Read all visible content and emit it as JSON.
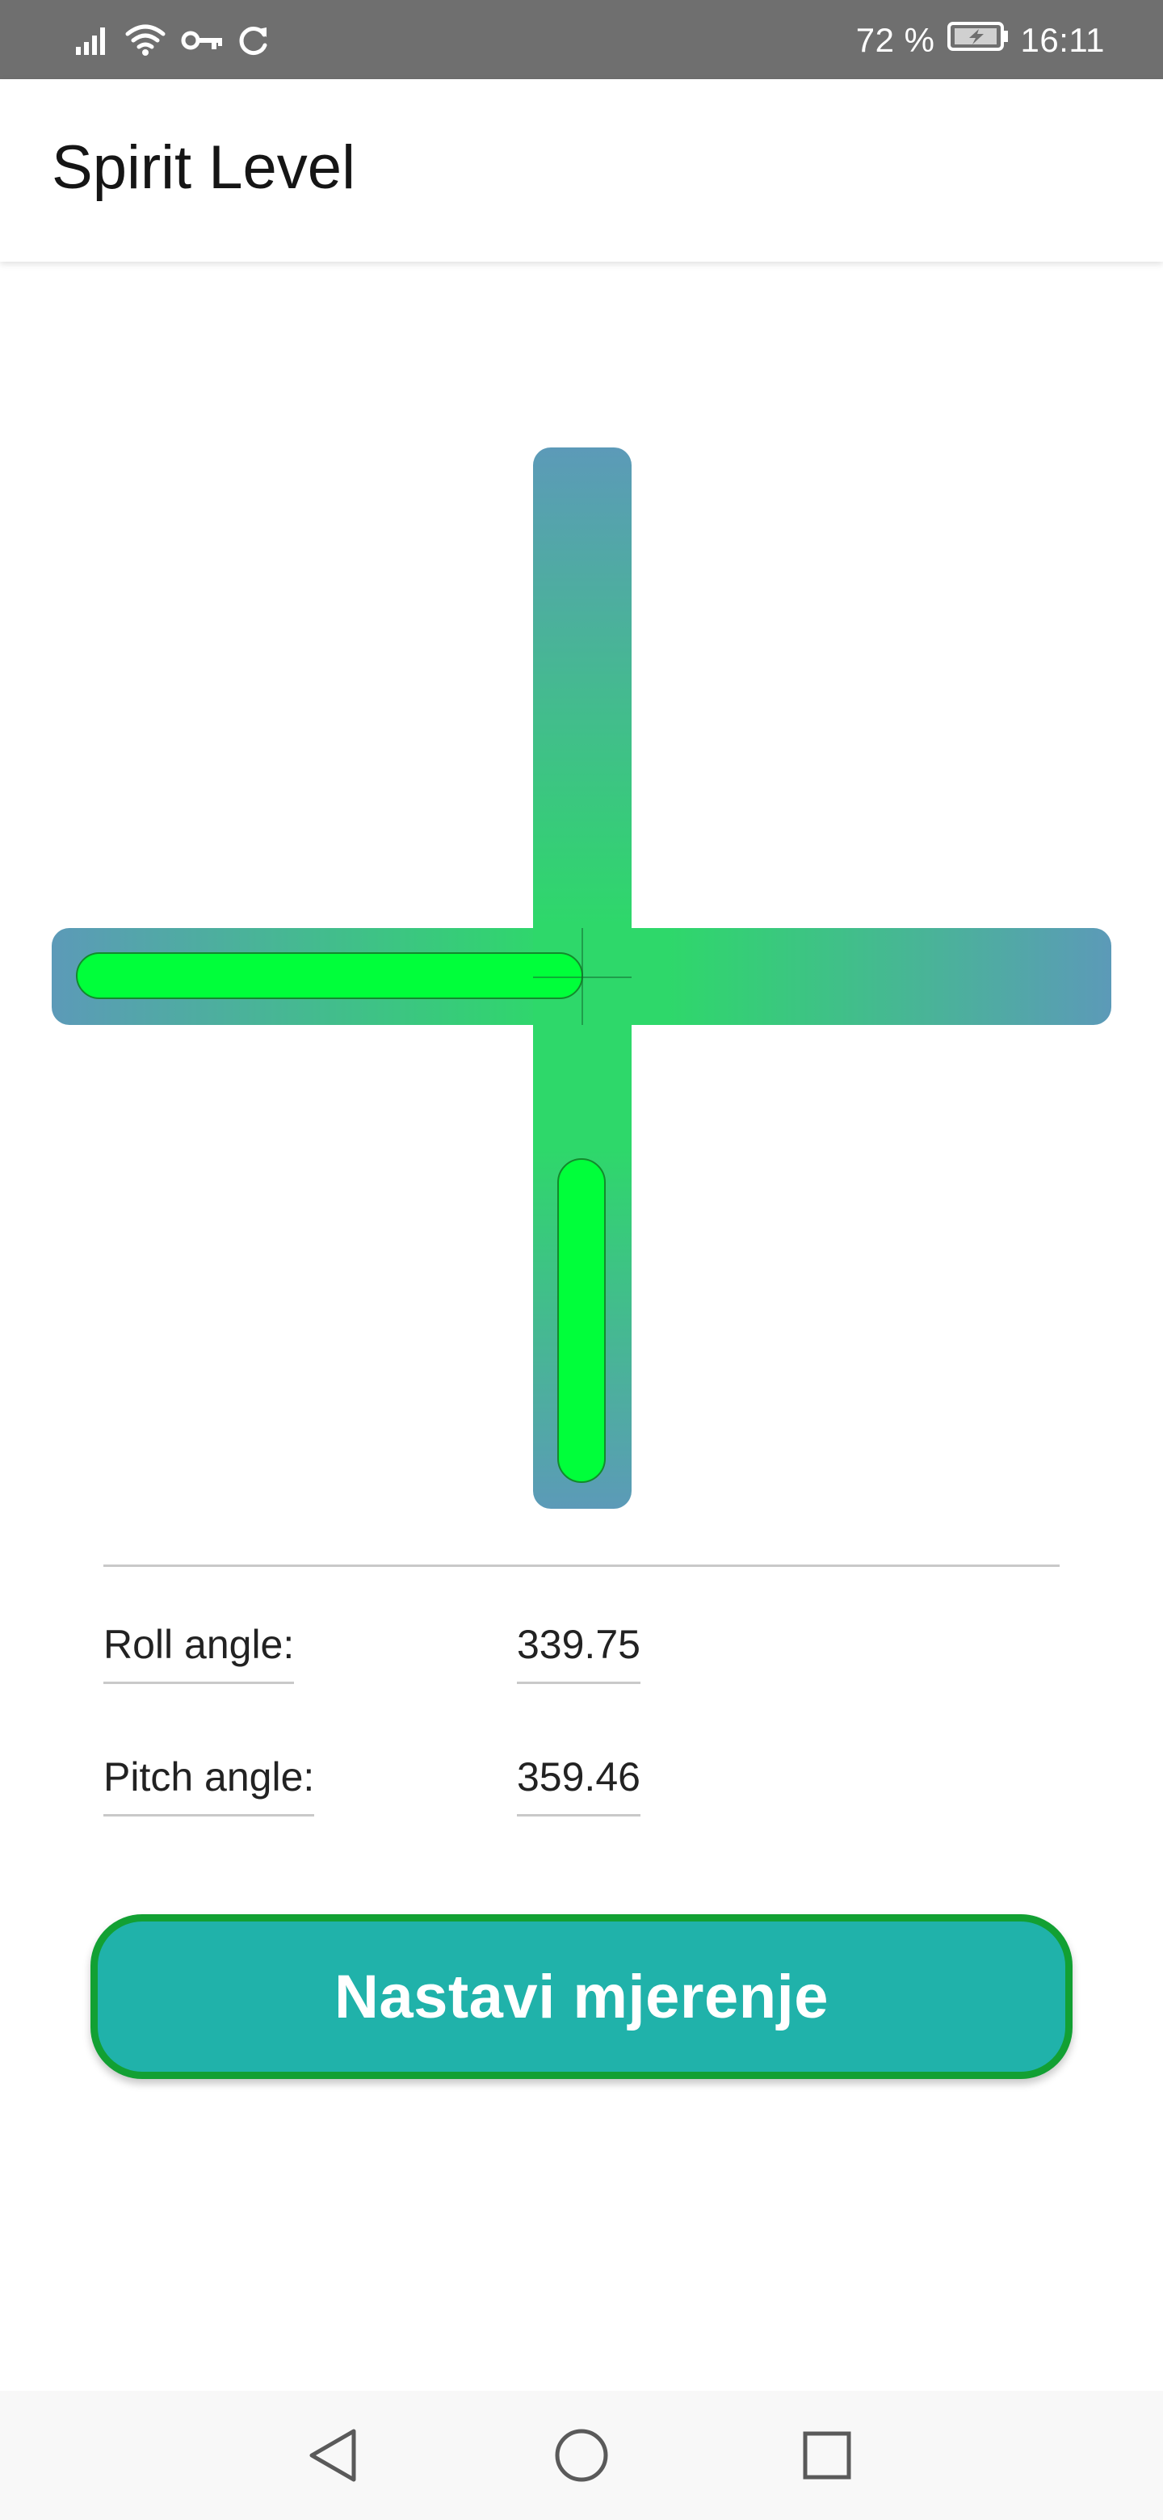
{
  "status_bar": {
    "icons": [
      "signal-icon",
      "wifi-icon",
      "vpn-key-icon",
      "sync-icon"
    ],
    "battery_percent": "72 %",
    "battery_icon": "battery-charging-icon",
    "time": "16:11"
  },
  "app_bar": {
    "title": "Spirit Level"
  },
  "level": {
    "track_color_center": "#2ed86a",
    "track_color_edge": "#5c9ab8",
    "bubble_color": "#00ff3a"
  },
  "readings": {
    "roll_label": "Roll angle:",
    "roll_value": "339.75",
    "pitch_label": "Pitch angle:",
    "pitch_value": "359.46"
  },
  "actions": {
    "continue_label": "Nastavi mjerenje",
    "button_fill": "#20b2aa",
    "button_border": "#12a033"
  },
  "nav_bar": {
    "buttons": [
      "back-icon",
      "home-icon",
      "recents-icon"
    ]
  }
}
